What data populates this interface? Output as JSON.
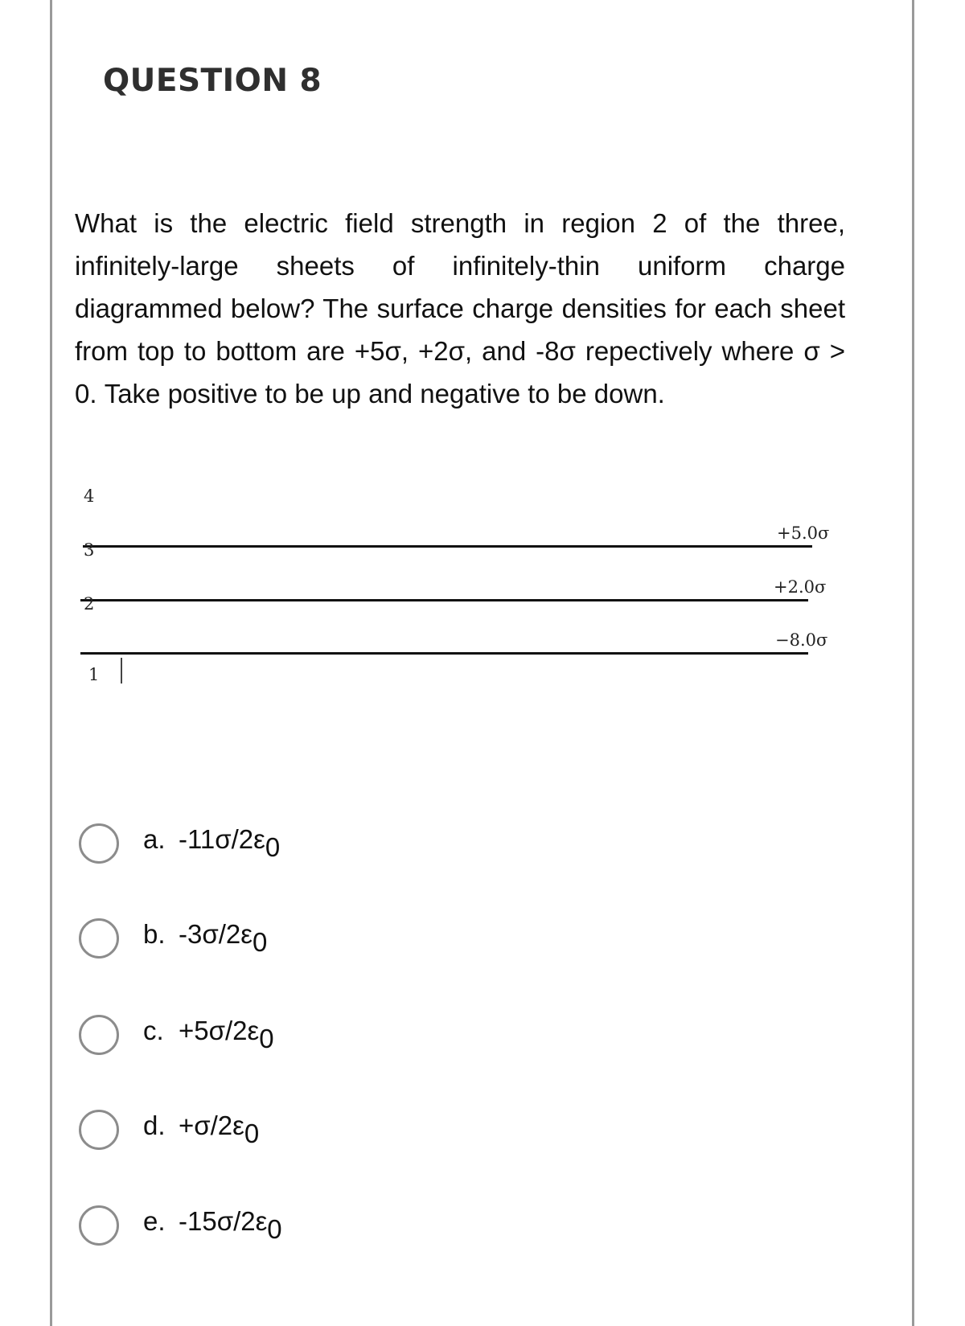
{
  "question": {
    "title": "QUESTION 8",
    "text": "What is the electric field strength in region 2 of the three, infinitely-large sheets of infinitely-thin uniform charge diagrammed below? The surface charge densities for each sheet from top to bottom are +5σ, +2σ, and -8σ repectively where σ > 0. Take positive to be up and negative to be down."
  },
  "diagram": {
    "regions": [
      "4",
      "3",
      "2",
      "1"
    ],
    "sheets": [
      {
        "charge_label": "+5.0σ",
        "density_sigma": 5.0
      },
      {
        "charge_label": "+2.0σ",
        "density_sigma": 2.0
      },
      {
        "charge_label": "−8.0σ",
        "density_sigma": -8.0
      }
    ]
  },
  "options": [
    {
      "letter": "a.",
      "expr": "-11σ/2ε",
      "sub": "0",
      "selected": false
    },
    {
      "letter": "b.",
      "expr": "-3σ/2ε",
      "sub": "0",
      "selected": false
    },
    {
      "letter": "c.",
      "expr": "+5σ/2ε",
      "sub": "0",
      "selected": false
    },
    {
      "letter": "d.",
      "expr": "+σ/2ε",
      "sub": "0",
      "selected": false
    },
    {
      "letter": "e.",
      "expr": "-15σ/2ε",
      "sub": "0",
      "selected": false
    }
  ]
}
